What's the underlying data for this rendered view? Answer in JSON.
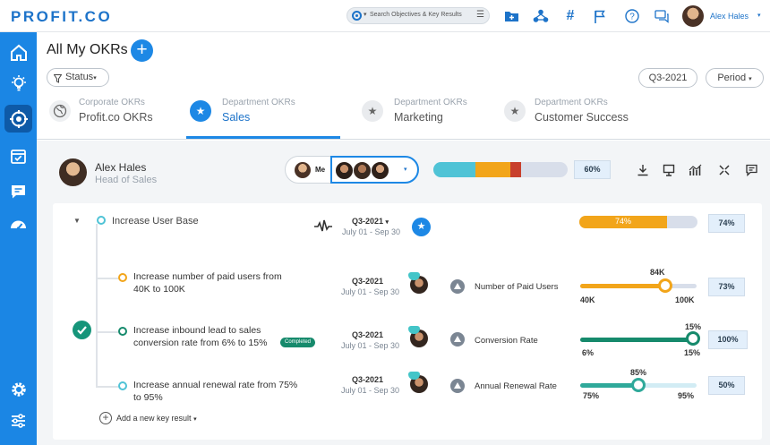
{
  "app": {
    "logo": "PROFIT.CO",
    "search_placeholder": "Search Objectives & Key Results",
    "user_name": "Alex Hales",
    "brand_color": "#1d88e5"
  },
  "header": {
    "title": "All My OKRs",
    "status_label": "Status",
    "quarter": "Q3-2021",
    "period_label": "Period"
  },
  "tabs": [
    {
      "sub": "Corporate OKRs",
      "label": "Profit.co OKRs",
      "icon": "globe-icon",
      "active": false
    },
    {
      "sub": "Department OKRs",
      "label": "Sales",
      "icon": "star-icon",
      "active": true
    },
    {
      "sub": "Department OKRs",
      "label": "Marketing",
      "icon": "star-icon",
      "active": false
    },
    {
      "sub": "Department OKRs",
      "label": "Customer Success",
      "icon": "star-icon",
      "active": false
    }
  ],
  "owner": {
    "name": "Alex Hales",
    "role": "Head of Sales",
    "me_label": "Me",
    "summary_pct": "60%",
    "summary_segments": [
      {
        "color": "#4fc3d6",
        "fraction": 0.31
      },
      {
        "color": "#f2a51a",
        "fraction": 0.26
      },
      {
        "color": "#c8402d",
        "fraction": 0.08
      }
    ]
  },
  "objective": {
    "title": "Increase User Base",
    "quarter": "Q3-2021",
    "range": "July 01 - Sep 30",
    "progress": 0.74,
    "progress_label": "74%",
    "pct": "74%",
    "add_kr_label": "Add a new key result"
  },
  "key_results": [
    {
      "title": "Increase number of paid users from 40K to 100K",
      "quarter": "Q3-2021",
      "range": "July 01 - Sep 30",
      "metric": "Number of Paid Users",
      "start": "40K",
      "end": "100K",
      "current": "84K",
      "progress": 0.73,
      "pct": "73%",
      "color": "#f2a51a",
      "completed": false
    },
    {
      "title": "Increase inbound lead to sales conversion rate from 6% to 15%",
      "quarter": "Q3-2021",
      "range": "July 01 - Sep 30",
      "metric": "Conversion Rate",
      "start": "6%",
      "end": "15%",
      "current": "15%",
      "progress": 1.0,
      "pct": "100%",
      "color": "#168a6c",
      "completed": true,
      "completed_label": "Completed"
    },
    {
      "title": "Increase annual renewal rate from 75% to 95%",
      "quarter": "Q3-2021",
      "range": "July 01 - Sep 30",
      "metric": "Annual Renewal Rate",
      "start": "75%",
      "end": "95%",
      "current": "85%",
      "progress": 0.5,
      "pct": "50%",
      "color": "#2fa99a",
      "completed": false
    }
  ]
}
